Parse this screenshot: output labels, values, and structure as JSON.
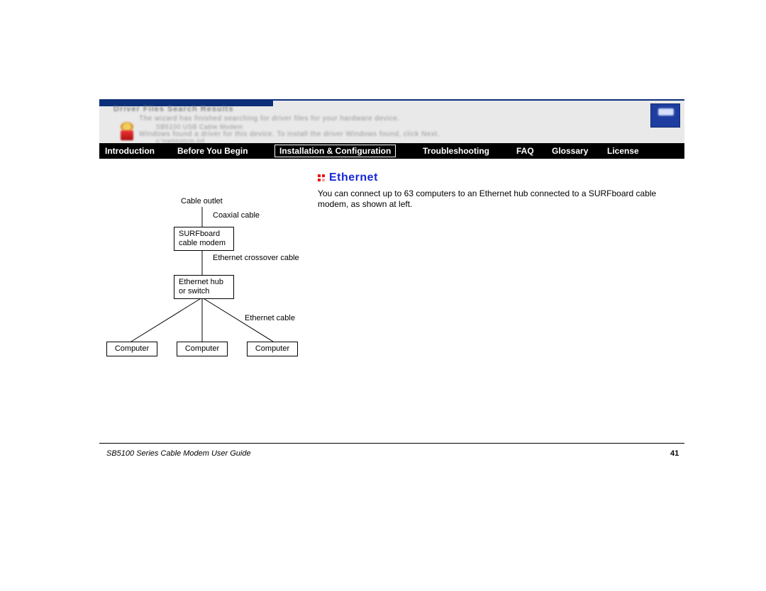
{
  "nav": {
    "introduction": "Introduction",
    "before": "Before You Begin",
    "install": "Installation & Configuration",
    "trouble": "Troubleshooting",
    "faq": "FAQ",
    "glossary": "Glossary",
    "license": "License"
  },
  "heading": "Ethernet",
  "paragraph": "You can connect up to 63 computers to an Ethernet hub connected to a SURFboard cable modem, as shown at left.",
  "diagram": {
    "cable_outlet": "Cable outlet",
    "coaxial_cable": "Coaxial cable",
    "modem_line1": "SURFboard",
    "modem_line2": "cable modem",
    "crossover": "Ethernet crossover cable",
    "hub_line1": "Ethernet hub",
    "hub_line2": "or switch",
    "eth_cable": "Ethernet cable",
    "computer": "Computer"
  },
  "footer": {
    "title": "SB5100 Series Cable Modem User Guide",
    "page": "41"
  },
  "chart_data": {
    "type": "diagram",
    "nodes": [
      {
        "id": "outlet",
        "label": "Cable outlet",
        "boxed": false
      },
      {
        "id": "modem",
        "label": "SURFboard cable modem",
        "boxed": true
      },
      {
        "id": "hub",
        "label": "Ethernet hub or switch",
        "boxed": true
      },
      {
        "id": "c1",
        "label": "Computer",
        "boxed": true
      },
      {
        "id": "c2",
        "label": "Computer",
        "boxed": true
      },
      {
        "id": "c3",
        "label": "Computer",
        "boxed": true
      }
    ],
    "edges": [
      {
        "from": "outlet",
        "to": "modem",
        "label": "Coaxial cable"
      },
      {
        "from": "modem",
        "to": "hub",
        "label": "Ethernet crossover cable"
      },
      {
        "from": "hub",
        "to": "c1",
        "label": "Ethernet cable"
      },
      {
        "from": "hub",
        "to": "c2",
        "label": "Ethernet cable"
      },
      {
        "from": "hub",
        "to": "c3",
        "label": "Ethernet cable"
      }
    ]
  }
}
